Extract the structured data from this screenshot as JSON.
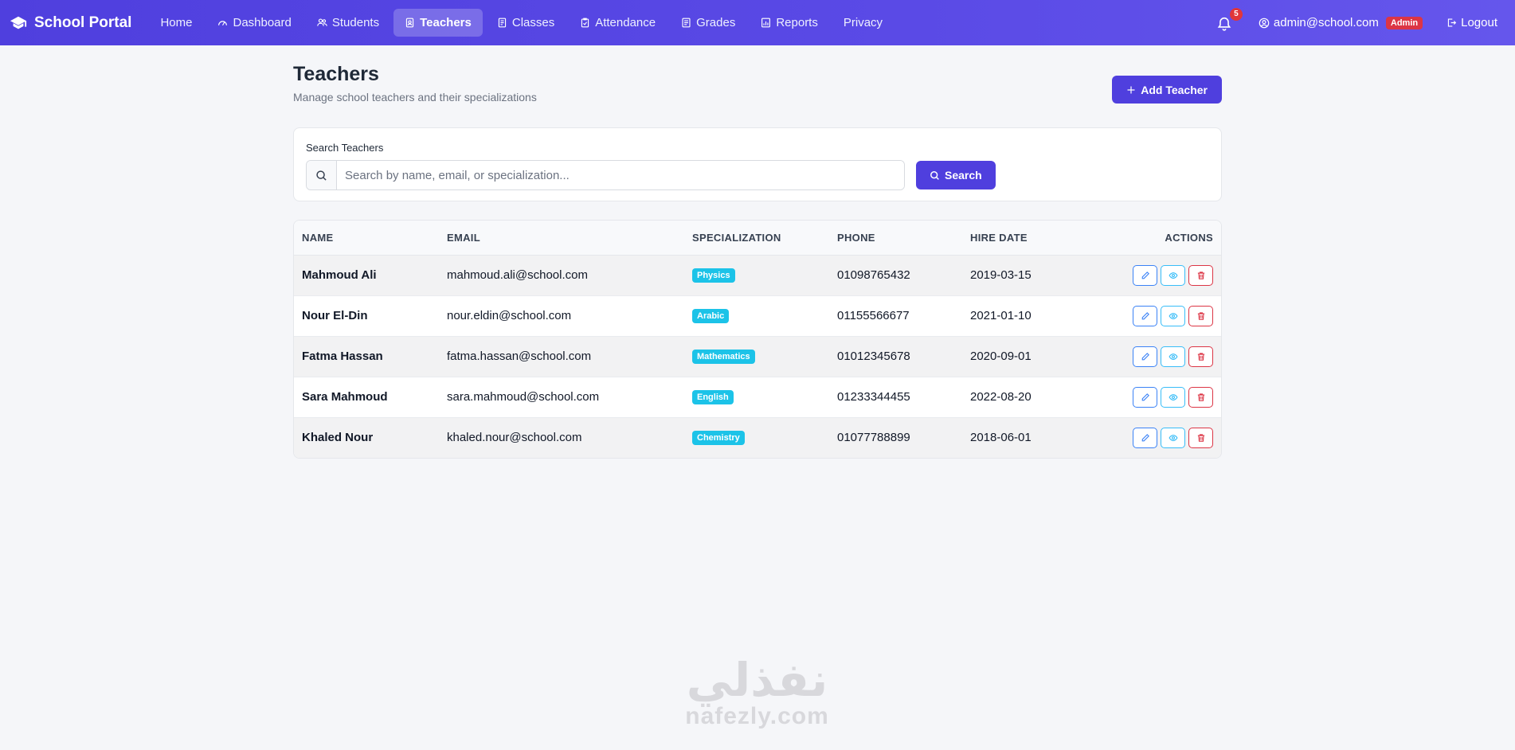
{
  "brand": {
    "name": "School Portal"
  },
  "nav": {
    "items": [
      {
        "label": "Home",
        "icon": "none"
      },
      {
        "label": "Dashboard",
        "icon": "speedometer-icon"
      },
      {
        "label": "Students",
        "icon": "people-icon"
      },
      {
        "label": "Teachers",
        "icon": "person-badge-icon",
        "active": true
      },
      {
        "label": "Classes",
        "icon": "book-icon"
      },
      {
        "label": "Attendance",
        "icon": "clipboard-check-icon"
      },
      {
        "label": "Grades",
        "icon": "journal-icon"
      },
      {
        "label": "Reports",
        "icon": "chart-icon"
      },
      {
        "label": "Privacy",
        "icon": "none"
      }
    ],
    "notifications_count": "5",
    "user_email": "admin@school.com",
    "user_role": "Admin",
    "logout_label": "Logout"
  },
  "page": {
    "title": "Teachers",
    "subtitle": "Manage school teachers and their specializations",
    "add_button_label": "Add Teacher"
  },
  "search": {
    "label": "Search Teachers",
    "placeholder": "Search by name, email, or specialization...",
    "value": "",
    "button_label": "Search"
  },
  "table": {
    "columns": {
      "name": "NAME",
      "email": "EMAIL",
      "specialization": "SPECIALIZATION",
      "phone": "PHONE",
      "hire_date": "HIRE DATE",
      "actions": "ACTIONS"
    },
    "rows": [
      {
        "name": "Mahmoud Ali",
        "email": "mahmoud.ali@school.com",
        "specialization": "Physics",
        "phone": "01098765432",
        "hire_date": "2019-03-15"
      },
      {
        "name": "Nour El-Din",
        "email": "nour.eldin@school.com",
        "specialization": "Arabic",
        "phone": "01155566677",
        "hire_date": "2021-01-10"
      },
      {
        "name": "Fatma Hassan",
        "email": "fatma.hassan@school.com",
        "specialization": "Mathematics",
        "phone": "01012345678",
        "hire_date": "2020-09-01"
      },
      {
        "name": "Sara Mahmoud",
        "email": "sara.mahmoud@school.com",
        "specialization": "English",
        "phone": "01233344455",
        "hire_date": "2022-08-20"
      },
      {
        "name": "Khaled Nour",
        "email": "khaled.nour@school.com",
        "specialization": "Chemistry",
        "phone": "01077788899",
        "hire_date": "2018-06-01"
      }
    ]
  },
  "watermark": {
    "arabic": "نفذلي",
    "latin": "nafezly.com"
  },
  "colors": {
    "primary": "#4f3fde",
    "badge_info": "#1cc3e8",
    "danger": "#dc3545"
  }
}
